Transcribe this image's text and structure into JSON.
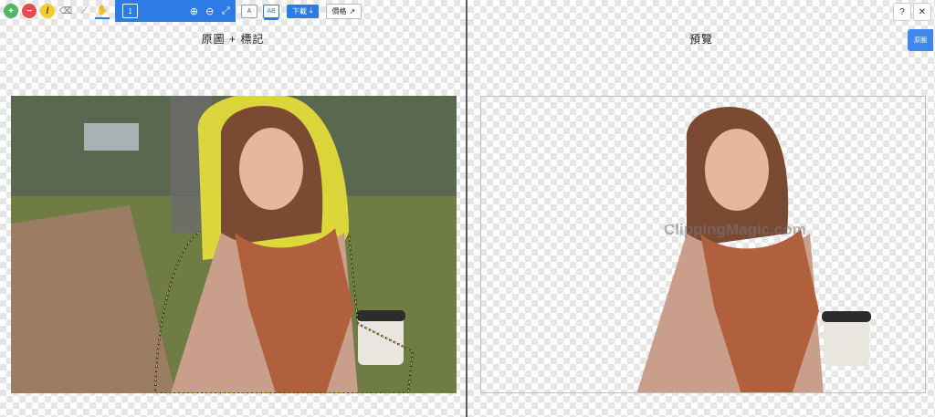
{
  "toolbar": {
    "tools": [
      {
        "name": "add-tool",
        "symbol": "+",
        "color": "#58b368"
      },
      {
        "name": "remove-tool",
        "symbol": "−",
        "color": "#e04e4e"
      },
      {
        "name": "hair-tool",
        "symbol": "/",
        "color": "#f2cd2b"
      },
      {
        "name": "eraser-tool",
        "symbol": "⌫",
        "color": "#777777"
      },
      {
        "name": "line-tool",
        "symbol": "⟋",
        "color": "#666666"
      },
      {
        "name": "hand-tool",
        "symbol": "✋",
        "color": "#444444"
      }
    ],
    "brush_size": "1",
    "zoom_in": "⊕",
    "zoom_out": "⊖",
    "fit": "⤢",
    "download_label": "下載",
    "price_label": "價格"
  },
  "left_pane": {
    "title": "原圖 + 標記"
  },
  "right_pane": {
    "title": "預覽",
    "watermark": "ClippingMagic.com",
    "original_tab": "原圖"
  },
  "window_controls": {
    "help": "?",
    "close": "✕"
  },
  "colors": {
    "accent": "#2d7be5",
    "mark_keep": "#e8e13a"
  }
}
